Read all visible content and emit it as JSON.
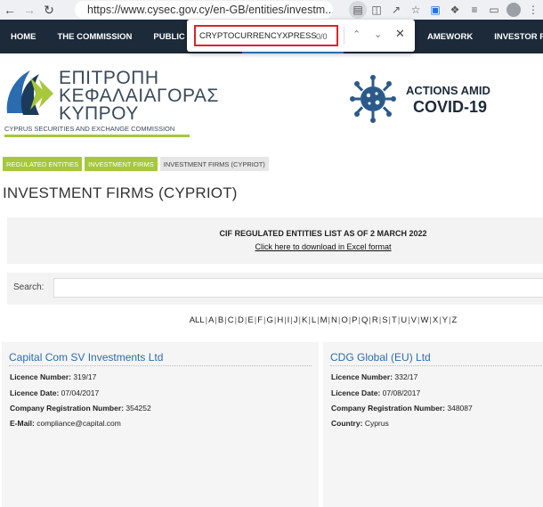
{
  "browser": {
    "url": "https://www.cysec.gov.cy/en-GB/entities/investm..."
  },
  "site_nav": {
    "items_left": [
      "HOME",
      "THE COMMISSION",
      "PUBLIC INF"
    ],
    "items_right": [
      "AMEWORK",
      "INVESTOR PROTE"
    ]
  },
  "find_bar": {
    "query": "CRYPTOCURRENCYXPRESS",
    "count": "0/0"
  },
  "logo": {
    "greek_line1": "ΕΠΙΤΡΟΠΗ",
    "greek_line2": "ΚΕΦΑΛΑΙΑΓΟΡΑΣ",
    "greek_line3": "ΚΥΠΡΟΥ",
    "english": "CYPRUS SECURITIES AND EXCHANGE COMMISSION"
  },
  "covid": {
    "line1": "ACTIONS AMID",
    "line2": "COVID-19"
  },
  "breadcrumb": [
    "REGULATED ENTITIES",
    "INVESTMENT FIRMS",
    "INVESTMENT FIRMS (CYPRIOT)"
  ],
  "page_title": "INVESTMENT FIRMS (CYPRIOT)",
  "cif_list": {
    "title": "CIF REGULATED ENTITIES LIST AS OF 2 MARCH 2022",
    "link": "Click here to download in Excel format"
  },
  "search": {
    "label": "Search:"
  },
  "alphabet": [
    "ALL",
    "A",
    "B",
    "C",
    "D",
    "E",
    "F",
    "G",
    "H",
    "I",
    "J",
    "K",
    "L",
    "M",
    "N",
    "O",
    "P",
    "Q",
    "R",
    "S",
    "T",
    "U",
    "V",
    "W",
    "X",
    "Y",
    "Z"
  ],
  "cards": [
    {
      "name": "Capital Com SV Investments Ltd",
      "fields": [
        {
          "label": "Licence Number",
          "value": "319/17"
        },
        {
          "label": "Licence Date",
          "value": "07/04/2017"
        },
        {
          "label": "Company Registration Number",
          "value": "354252"
        },
        {
          "label": "E-Mail",
          "value": "compliance@capital.com"
        }
      ]
    },
    {
      "name": "CDG Global (EU) Ltd",
      "fields": [
        {
          "label": "Licence Number",
          "value": "332/17"
        },
        {
          "label": "Licence Date",
          "value": "07/08/2017"
        },
        {
          "label": "Company Registration Number",
          "value": "348087"
        },
        {
          "label": "Country",
          "value": "Cyprus"
        }
      ]
    }
  ],
  "colors": {
    "nav_bg": "#1c2a3a",
    "accent_green": "#a6c83a",
    "link_blue": "#2b6cb0",
    "find_border": "#d9252a"
  }
}
